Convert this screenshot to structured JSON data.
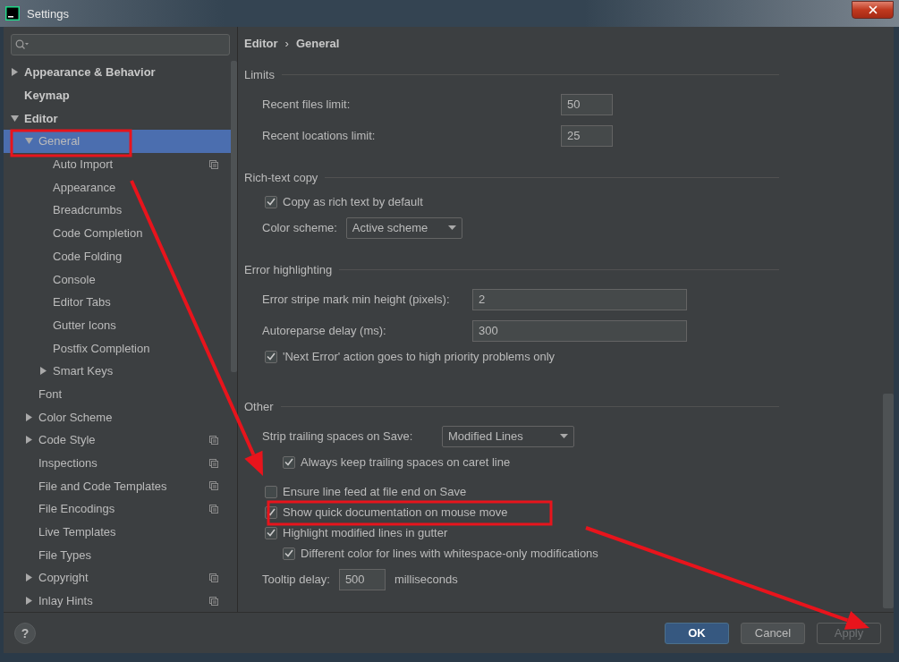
{
  "window": {
    "title": "Settings"
  },
  "tree": [
    {
      "label": "Appearance & Behavior",
      "selected": false,
      "expanded": false,
      "project_level": false
    },
    {
      "label": "Keymap",
      "selected": false,
      "project_level": false
    },
    {
      "label": "Editor",
      "selected": false,
      "expanded": true,
      "project_level": false,
      "children": [
        {
          "label": "General",
          "selected": true,
          "expanded": true,
          "project_level": false,
          "children": [
            {
              "label": "Auto Import",
              "selected": false,
              "project_level": true
            },
            {
              "label": "Appearance",
              "selected": false,
              "project_level": false
            },
            {
              "label": "Breadcrumbs",
              "selected": false,
              "project_level": false
            },
            {
              "label": "Code Completion",
              "selected": false,
              "project_level": false
            },
            {
              "label": "Code Folding",
              "selected": false,
              "project_level": false
            },
            {
              "label": "Console",
              "selected": false,
              "project_level": false
            },
            {
              "label": "Editor Tabs",
              "selected": false,
              "project_level": false
            },
            {
              "label": "Gutter Icons",
              "selected": false,
              "project_level": false
            },
            {
              "label": "Postfix Completion",
              "selected": false,
              "project_level": false
            },
            {
              "label": "Smart Keys",
              "selected": false,
              "expanded": false,
              "project_level": false
            }
          ]
        },
        {
          "label": "Font",
          "selected": false,
          "project_level": false
        },
        {
          "label": "Color Scheme",
          "selected": false,
          "expanded": false,
          "project_level": false
        },
        {
          "label": "Code Style",
          "selected": false,
          "expanded": false,
          "project_level": true
        },
        {
          "label": "Inspections",
          "selected": false,
          "project_level": true
        },
        {
          "label": "File and Code Templates",
          "selected": false,
          "project_level": true
        },
        {
          "label": "File Encodings",
          "selected": false,
          "project_level": true
        },
        {
          "label": "Live Templates",
          "selected": false,
          "project_level": false
        },
        {
          "label": "File Types",
          "selected": false,
          "project_level": false
        },
        {
          "label": "Copyright",
          "selected": false,
          "expanded": false,
          "project_level": true
        },
        {
          "label": "Inlay Hints",
          "selected": false,
          "expanded": false,
          "project_level": true
        }
      ]
    }
  ],
  "breadcrumb": {
    "items": [
      "Editor",
      "General"
    ],
    "separator": "›"
  },
  "sections": [
    {
      "title": "Limits",
      "rows": [
        {
          "kind": "field",
          "label": "Recent files limit:",
          "value": "50"
        },
        {
          "kind": "field",
          "label": "Recent locations limit:",
          "value": "25"
        }
      ]
    },
    {
      "title": "Rich-text copy",
      "rows": [
        {
          "kind": "checkbox",
          "label": "Copy as rich text by default",
          "checked": true
        },
        {
          "kind": "dropdown",
          "label": "Color scheme:",
          "value": "Active scheme"
        }
      ]
    },
    {
      "title": "Error highlighting",
      "rows": [
        {
          "kind": "field",
          "label": "Error stripe mark min height (pixels):",
          "value": "2"
        },
        {
          "kind": "field",
          "label": "Autoreparse delay (ms):",
          "value": "300"
        },
        {
          "kind": "checkbox",
          "label": "'Next Error' action goes to high priority problems only",
          "checked": true
        }
      ]
    },
    {
      "title": "Other",
      "rows": [
        {
          "kind": "dropdown",
          "label": "Strip trailing spaces on Save:",
          "value": "Modified Lines",
          "children": [
            {
              "kind": "checkbox",
              "label": "Always keep trailing spaces on caret line",
              "checked": true
            }
          ]
        },
        {
          "kind": "checkbox",
          "label": "Ensure line feed at file end on Save",
          "checked": false
        },
        {
          "kind": "checkbox",
          "label": "Show quick documentation on mouse move",
          "checked": true
        },
        {
          "kind": "checkbox",
          "label": "Highlight modified lines in gutter",
          "checked": true,
          "children": [
            {
              "kind": "checkbox",
              "label": "Different color for lines with whitespace-only modifications",
              "checked": true
            }
          ]
        },
        {
          "kind": "field_unit",
          "label": "Tooltip delay:",
          "value": "500",
          "unit": "milliseconds"
        }
      ]
    }
  ],
  "footer": {
    "help": "?",
    "buttons": [
      {
        "label": "OK",
        "kind": "primary",
        "disabled": false
      },
      {
        "label": "Cancel",
        "kind": "default",
        "disabled": false
      },
      {
        "label": "Apply",
        "kind": "default",
        "disabled": true
      }
    ]
  }
}
